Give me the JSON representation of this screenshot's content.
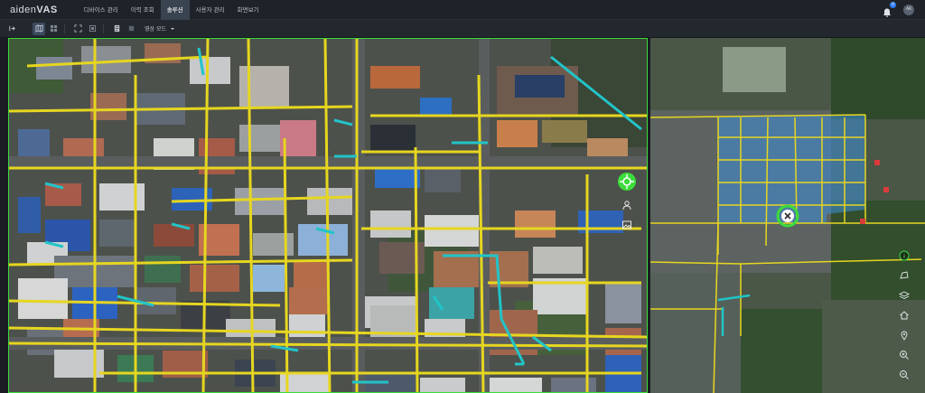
{
  "app": {
    "logo_light": "aiden",
    "logo_bold": "VAS"
  },
  "nav": {
    "items": [
      {
        "label": "디바이스 관리",
        "active": false
      },
      {
        "label": "이력 조회",
        "active": false
      },
      {
        "label": "솔루션",
        "active": true
      },
      {
        "label": "사용자 관리",
        "active": false
      },
      {
        "label": "화면보기",
        "active": false
      }
    ]
  },
  "header": {
    "notification_count": "0",
    "avatar_initials": "AK"
  },
  "toolbar": {
    "view_mode_label": "영상 모드",
    "dropdown_icon": "chevron-down-icon"
  },
  "colors": {
    "accent_green": "#3cdc3c",
    "road_yellow": "#e6d620",
    "path_cyan": "#21c4c8"
  }
}
